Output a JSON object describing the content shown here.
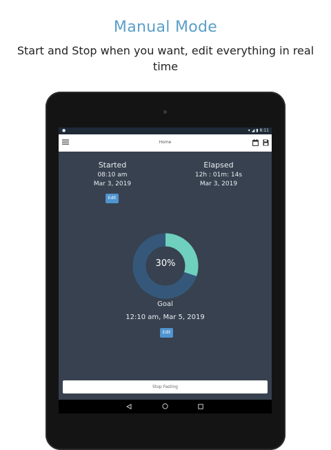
{
  "promo": {
    "headline": "Manual Mode",
    "subline": "Start and Stop when you want, edit everything in real time"
  },
  "statusbar": {
    "time": "8:11"
  },
  "appbar": {
    "title": "Home"
  },
  "started": {
    "title": "Started",
    "time": "08:10 am",
    "date": "Mar 3, 2019",
    "edit_label": "Edit"
  },
  "elapsed": {
    "title": "Elapsed",
    "duration": "12h : 01m: 14s",
    "date": "Mar 3, 2019"
  },
  "progress": {
    "label": "30%",
    "fraction": 0.3,
    "track_color": "#35587a",
    "fill_color": "#6fd0bd"
  },
  "goal": {
    "title": "Goal",
    "value": "12:10 am, Mar 5, 2019",
    "edit_label": "Edit"
  },
  "actions": {
    "stop_label": "Stop Fasting"
  },
  "colors": {
    "screen_bg": "#37414f",
    "accent": "#4f94cf",
    "headline": "#5a9fc7"
  }
}
